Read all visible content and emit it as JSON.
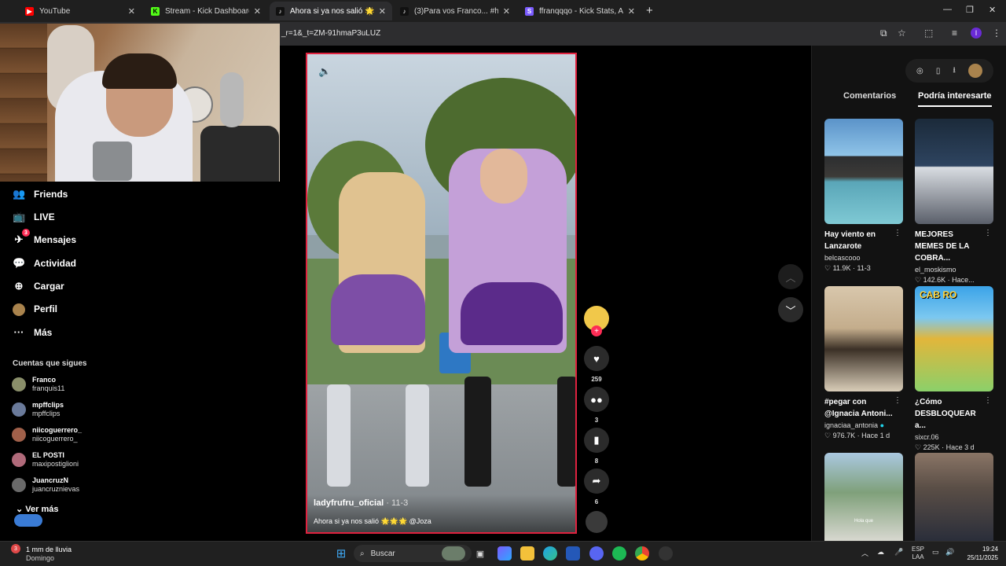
{
  "browser": {
    "tabs": [
      {
        "label": "YouTube",
        "icon": "youtube-icon",
        "color": "#ff0000"
      },
      {
        "label": "Stream - Kick Dashboard",
        "icon": "kick-icon",
        "color": "#53fc18"
      },
      {
        "label": "Ahora si ya nos salió 🌟🌟🌟",
        "icon": "tiktok-icon",
        "color": "#ffffff"
      },
      {
        "label": "(3)Para vos Franco... #humor #g",
        "icon": "tiktok-icon",
        "color": "#ffffff"
      },
      {
        "label": "ffranqqqo - Kick Stats, Analytic",
        "icon": "streamscharts-icon",
        "color": "#7b5cff"
      }
    ],
    "new_tab_glyph": "+",
    "url": "_r=1&_t=ZM-91hmaP3uLUZ",
    "close_glyph": "✕"
  },
  "sidebar": {
    "items": [
      {
        "label": "Friends",
        "icon": "friends-icon",
        "glyph": "👥"
      },
      {
        "label": "LIVE",
        "icon": "live-icon",
        "glyph": "📺"
      },
      {
        "label": "Mensajes",
        "icon": "messages-icon",
        "glyph": "✈",
        "badge": "3"
      },
      {
        "label": "Actividad",
        "icon": "activity-icon",
        "glyph": "💬"
      },
      {
        "label": "Cargar",
        "icon": "upload-icon",
        "glyph": "⊕"
      },
      {
        "label": "Perfil",
        "icon": "profile-avatar",
        "glyph": ""
      },
      {
        "label": "Más",
        "icon": "more-icon",
        "glyph": "···"
      }
    ],
    "following_title": "Cuentas que sigues",
    "following": [
      {
        "name": "Franco",
        "handle": "franquis11",
        "color": "#8a8f6a"
      },
      {
        "name": "mpffclips",
        "handle": "mpffclips",
        "color": "#6a7a9a"
      },
      {
        "name": "niicoguerrero_",
        "handle": "niicoguerrero_",
        "color": "#a0604a"
      },
      {
        "name": "EL POSTI",
        "handle": "maxipostiglioni",
        "color": "#b06a7a"
      },
      {
        "name": "JuancruzN",
        "handle": "juancruznievas",
        "color": "#6a6a6a"
      }
    ],
    "see_more": "Ver más"
  },
  "video": {
    "author": "ladyfrufru_oficial",
    "date": "· 11-3",
    "caption": "Ahora si ya nos salió 🌟🌟🌟 @Joza",
    "progress": 0.7,
    "volume_icon": "volume-icon"
  },
  "actions": {
    "likes": "259",
    "comments": "3",
    "saves": "8",
    "shares": "6"
  },
  "right_panel": {
    "tabs": [
      "Comentarios",
      "Podría interesarte"
    ],
    "active_tab": "Podría interesarte",
    "cards": [
      {
        "title": "Hay viento en Lanzarote",
        "author": "belcascooo",
        "likes": "11.9K",
        "date": "11-3",
        "thumb": "beach"
      },
      {
        "title": "MEJORES MEMES DE LA COBRA...",
        "author": "el_moskismo",
        "likes": "142.6K",
        "date": "Hace...",
        "thumb": "stream"
      },
      {
        "title": "#pegar con @Ignacia Antoni...",
        "author": "ignaciaa_antonia",
        "likes": "976.7K",
        "date": "Hace 1 d",
        "thumb": "family",
        "verified": true
      },
      {
        "title": "¿Cómo DESBLOQUEAR a...",
        "author": "sixcr.06",
        "likes": "225K",
        "date": "Hace 3 d",
        "thumb": "game"
      },
      {
        "title": "",
        "author": "",
        "likes": "",
        "date": "",
        "thumb": "street"
      },
      {
        "title": "",
        "author": "",
        "likes": "",
        "date": "",
        "thumb": "woman"
      }
    ],
    "card4_overlay": "CAB    RO",
    "card5_overlay": "Hola que"
  },
  "taskbar": {
    "weather_badge": "3",
    "weather_title": "1 mm de lluvia",
    "weather_sub": "Domingo",
    "search_label": "Buscar",
    "lang": "ESP",
    "lang_sub": "LAA",
    "time": "19:24",
    "date": "25/11/2025"
  },
  "colors": {
    "accent": "#fe2c55",
    "panel": "#121212",
    "video_border": "#e0223f"
  }
}
